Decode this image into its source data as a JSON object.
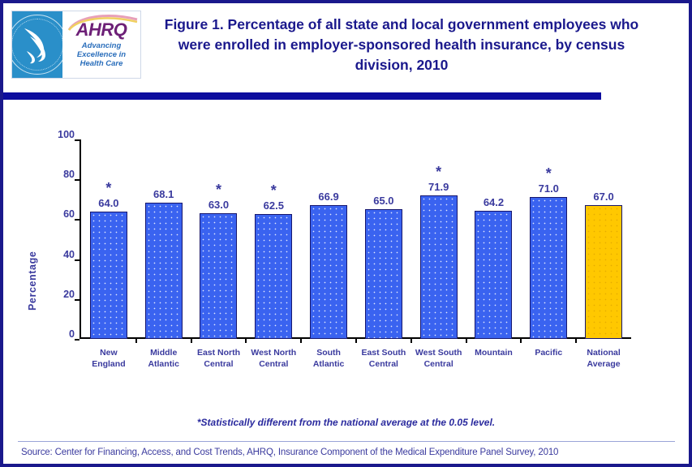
{
  "figure": {
    "title": "Figure 1. Percentage of all state and local government employees who were enrolled in employer-sponsored health insurance, by census division, 2010",
    "border_color": "#1a188c",
    "rule_color": "#0d0d9e"
  },
  "logo": {
    "seal_alt": "department-of-health-and-human-services-seal",
    "seal_ring_text": "DEPARTMENT OF HEALTH & HUMAN SERVICES - USA",
    "wordmark": "AHRQ",
    "tagline": "Advancing\nExcellence in\nHealth Care",
    "wordmark_color": "#6d2077",
    "tagline_color": "#2a6ebb",
    "seal_color": "#2a8fc9"
  },
  "footnotes": {
    "significance": "*Statistically different from the national average at the 0.05 level.",
    "source": "Source: Center for Financing, Access, and Cost Trends, AHRQ, Insurance Component of the Medical Expenditure Panel Survey,  2010"
  },
  "chart_data": {
    "type": "bar",
    "title": "Figure 1. Percentage of all state and local government employees who were enrolled in employer-sponsored health insurance, by census division, 2010",
    "xlabel": "",
    "ylabel": "Percentage",
    "ylim": [
      0,
      100
    ],
    "yticks": [
      0,
      20,
      40,
      60,
      80,
      100
    ],
    "ytick_labels": [
      "0",
      "20",
      "40",
      "60",
      "80",
      "100"
    ],
    "grid": false,
    "legend": false,
    "categories": [
      "New\nEngland",
      "Middle\nAtlantic",
      "East North\nCentral",
      "West North\nCentral",
      "South\nAtlantic",
      "East South\nCentral",
      "West South\nCentral",
      "Mountain",
      "Pacific",
      "National\nAverage"
    ],
    "values": [
      64.0,
      68.1,
      63.0,
      62.5,
      66.9,
      65.0,
      71.9,
      64.2,
      71.0,
      67.0
    ],
    "value_labels": [
      "64.0",
      "68.1",
      "63.0",
      "62.5",
      "66.9",
      "65.0",
      "71.9",
      "64.2",
      "71.0",
      "67.0"
    ],
    "significance_markers": [
      true,
      false,
      true,
      true,
      false,
      false,
      true,
      false,
      true,
      false
    ],
    "significance_symbol": "✳",
    "bar_colors": [
      "#3a63f0",
      "#3a63f0",
      "#3a63f0",
      "#3a63f0",
      "#3a63f0",
      "#3a63f0",
      "#3a63f0",
      "#3a63f0",
      "#3a63f0",
      "#ffc800"
    ],
    "highlight_category": "National\nAverage",
    "highlight_color": "#ffc800",
    "series_color": "#3a63f0",
    "bar_border_color": "#16166e",
    "text_color": "#3a3a9e"
  }
}
